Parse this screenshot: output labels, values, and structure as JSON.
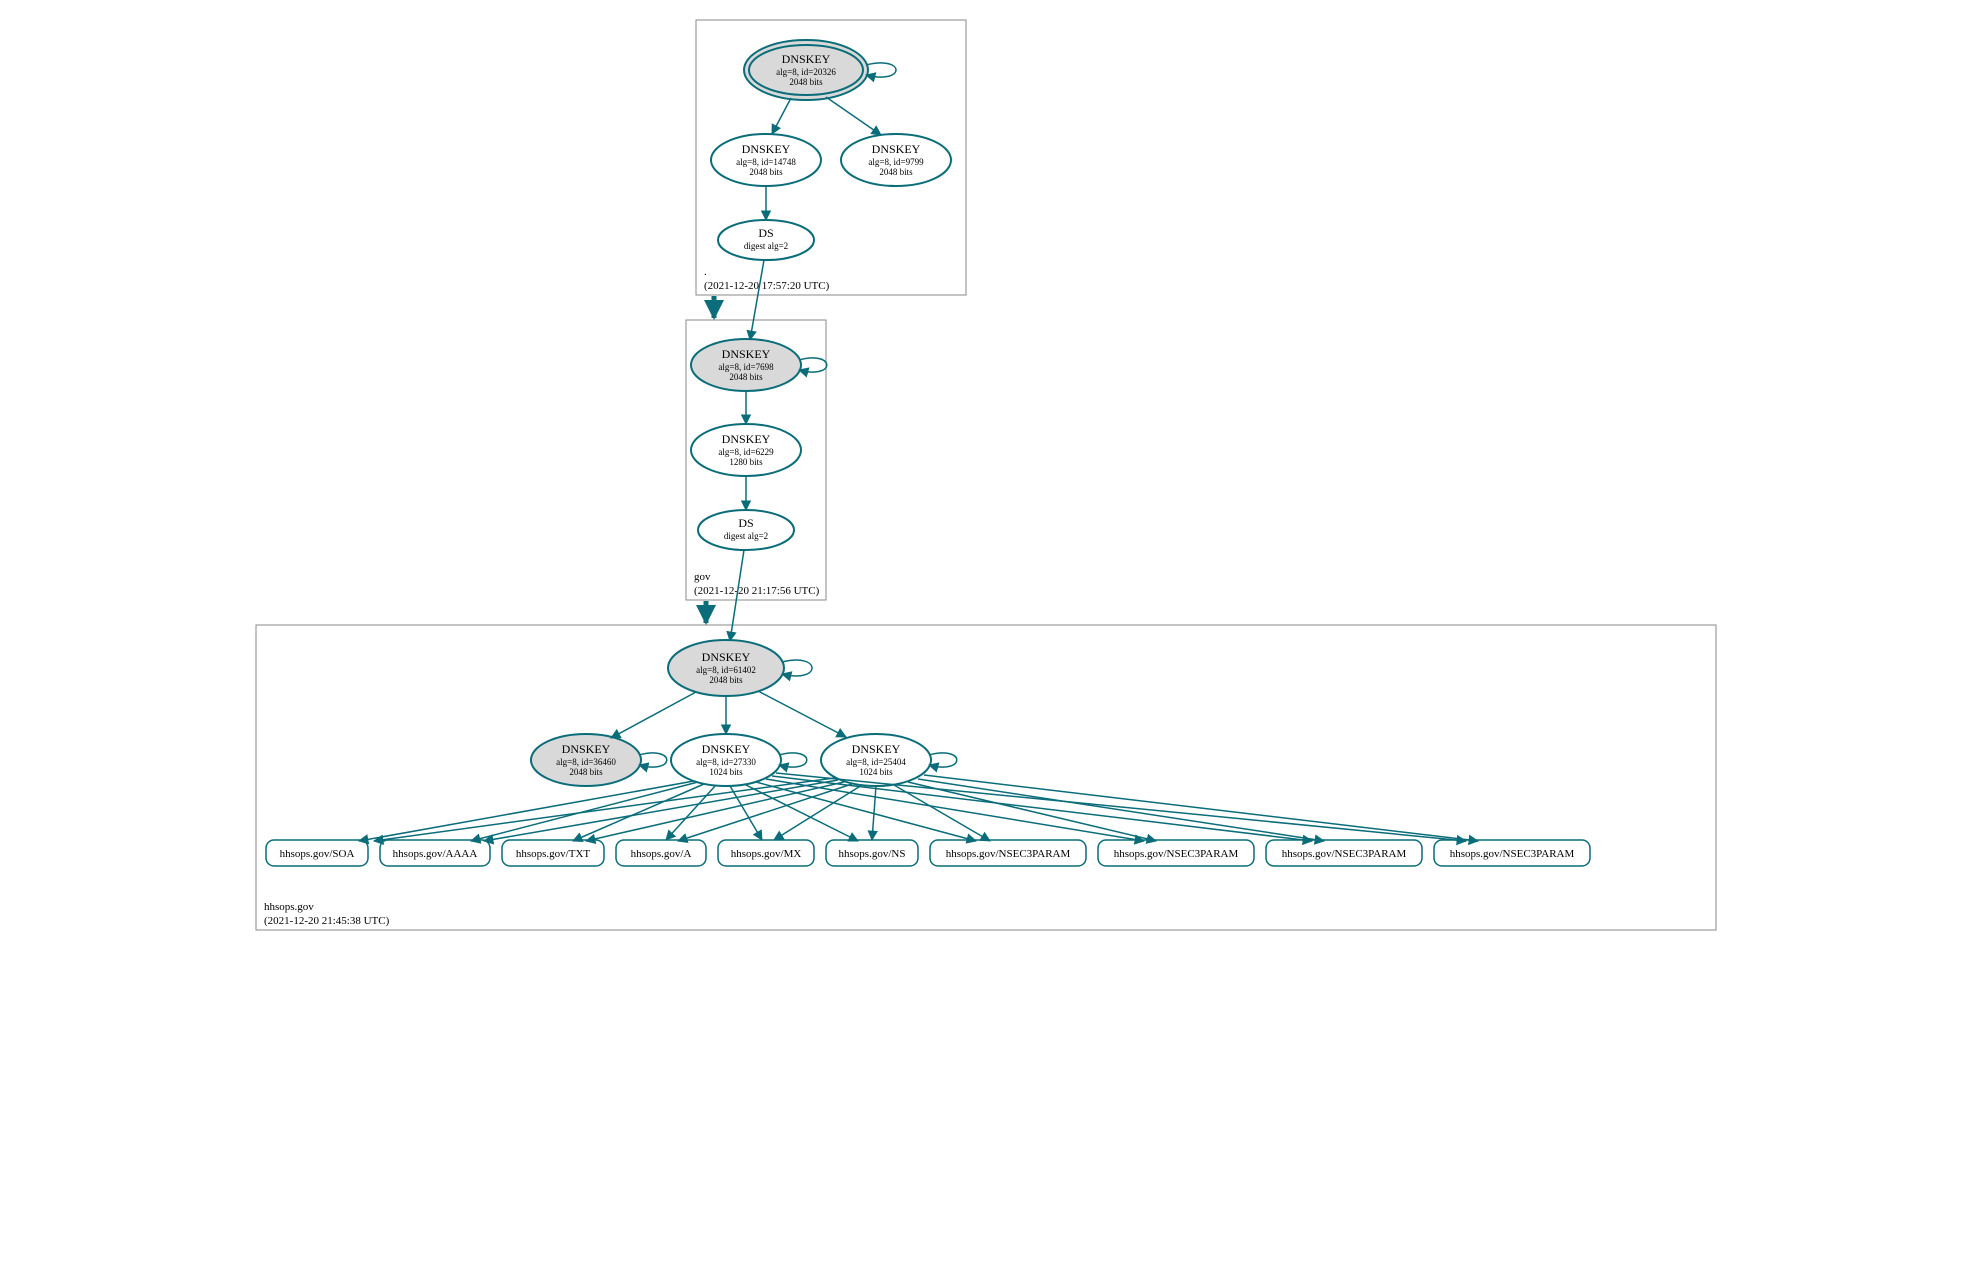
{
  "zones": {
    "root": {
      "name": ".",
      "timestamp": "(2021-12-20 17:57:20 UTC)"
    },
    "gov": {
      "name": "gov",
      "timestamp": "(2021-12-20 21:17:56 UTC)"
    },
    "leaf": {
      "name": "hhsops.gov",
      "timestamp": "(2021-12-20 21:45:38 UTC)"
    }
  },
  "nodes": {
    "rootKSK": {
      "title": "DNSKEY",
      "l1": "alg=8, id=20326",
      "l2": "2048 bits"
    },
    "rootZ1": {
      "title": "DNSKEY",
      "l1": "alg=8, id=14748",
      "l2": "2048 bits"
    },
    "rootZ2": {
      "title": "DNSKEY",
      "l1": "alg=8, id=9799",
      "l2": "2048 bits"
    },
    "rootDS": {
      "title": "DS",
      "l1": "digest alg=2",
      "l2": ""
    },
    "govKSK": {
      "title": "DNSKEY",
      "l1": "alg=8, id=7698",
      "l2": "2048 bits"
    },
    "govZ": {
      "title": "DNSKEY",
      "l1": "alg=8, id=6229",
      "l2": "1280 bits"
    },
    "govDS": {
      "title": "DS",
      "l1": "digest alg=2",
      "l2": ""
    },
    "leafKSK": {
      "title": "DNSKEY",
      "l1": "alg=8, id=61402",
      "l2": "2048 bits"
    },
    "leafZA": {
      "title": "DNSKEY",
      "l1": "alg=8, id=36460",
      "l2": "2048 bits"
    },
    "leafZB": {
      "title": "DNSKEY",
      "l1": "alg=8, id=27330",
      "l2": "1024 bits"
    },
    "leafZC": {
      "title": "DNSKEY",
      "l1": "alg=8, id=25404",
      "l2": "1024 bits"
    }
  },
  "records": {
    "r0": "hhsops.gov/SOA",
    "r1": "hhsops.gov/AAAA",
    "r2": "hhsops.gov/TXT",
    "r3": "hhsops.gov/A",
    "r4": "hhsops.gov/MX",
    "r5": "hhsops.gov/NS",
    "r6": "hhsops.gov/NSEC3PARAM",
    "r7": "hhsops.gov/NSEC3PARAM",
    "r8": "hhsops.gov/NSEC3PARAM",
    "r9": "hhsops.gov/NSEC3PARAM"
  }
}
